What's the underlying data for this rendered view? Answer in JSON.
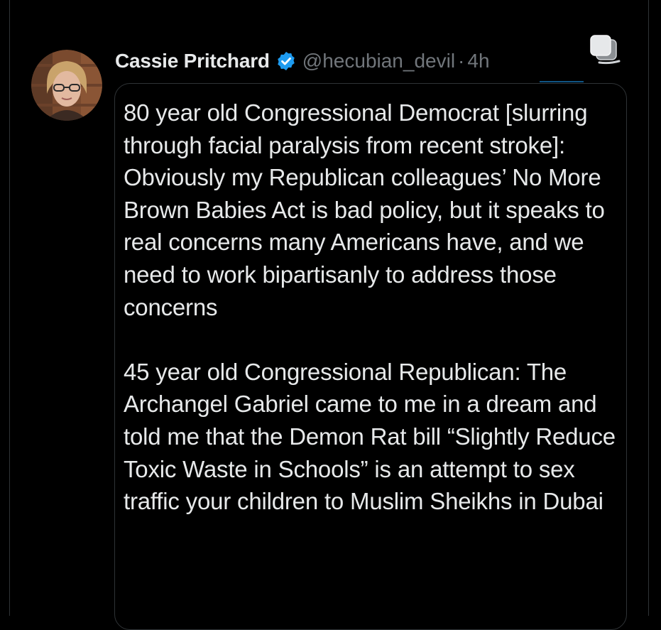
{
  "post": {
    "author": {
      "display_name": "Cassie Pritchard",
      "handle": "@hecubian_devil",
      "separator": "·",
      "timestamp": "4h",
      "verified_icon": "verified-badge-icon",
      "avatar_icon": "profile-avatar"
    },
    "quote": {
      "paragraph_1": "80 year old Congressional Democrat [slurring through facial paralysis from recent stroke]: Obviously my Republican colleagues’ No More Brown Babies Act is bad policy, but it speaks to real concerns many Americans have, and we need to work bipartisanly to address those concerns",
      "paragraph_2": "45 year old Congressional Republican: The Archangel Gabriel came to me in a dream and told me that the Demon Rat bill “Slightly Reduce Toxic Waste in Schools” is an attempt to sex traffic your children to Muslim Sheikhs in Dubai"
    },
    "actions": {
      "copy_icon": "copy-icon"
    }
  },
  "colors": {
    "background": "#000000",
    "primary_text": "#e7e9ea",
    "secondary_text": "#71767b",
    "border": "#2f3336",
    "verified_blue": "#1d9bf0"
  }
}
